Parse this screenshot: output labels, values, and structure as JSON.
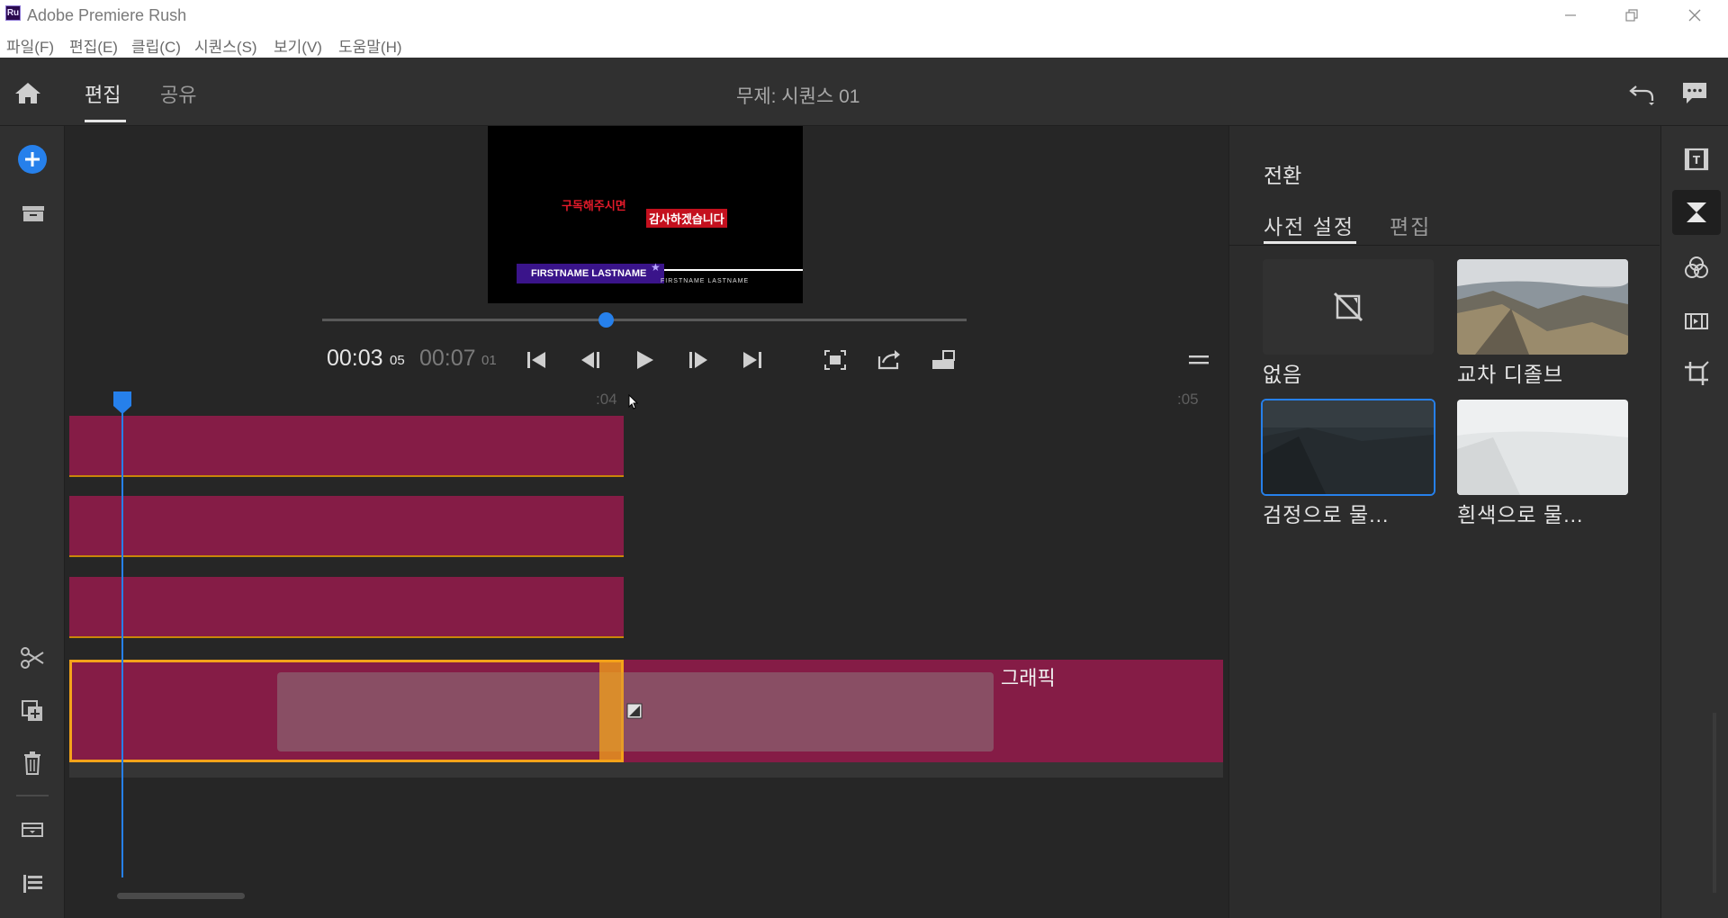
{
  "window": {
    "app_logo": "Ru",
    "title": "Adobe Premiere Rush",
    "buttons": [
      "minimize-icon",
      "restore-icon",
      "close-icon"
    ]
  },
  "menu": {
    "items": [
      "파일(F)",
      "편집(E)",
      "클립(C)",
      "시퀀스(S)",
      "보기(V)",
      "도움말(H)"
    ]
  },
  "header": {
    "tabs": [
      "편집",
      "공유"
    ],
    "active_tab": "편집",
    "project_title": "무제: 시퀀스 01"
  },
  "preview": {
    "red_text": "구독해주시면",
    "highlight_text": "감사하겠습니다",
    "lower_third_name": "FIRSTNAME LASTNAME",
    "lower_third_sub": "FIRSTNAME LASTNAME",
    "scrub_progress": 0.44
  },
  "transport": {
    "current_time": "00:03",
    "current_frames": "05",
    "duration_time": "00:07",
    "duration_frames": "01"
  },
  "timeline": {
    "ruler_labels": [
      ":04",
      ":05"
    ],
    "graphic_track_label": "그래픽"
  },
  "right_panel": {
    "title": "전환",
    "tabs": [
      "사전 설정",
      "편집"
    ],
    "active_tab": "사전 설정",
    "presets": [
      {
        "label": "없음",
        "selected": false
      },
      {
        "label": "교차 디졸브",
        "selected": false
      },
      {
        "label": "검정으로 물...",
        "selected": true
      },
      {
        "label": "흰색으로 물...",
        "selected": false
      }
    ]
  },
  "colors": {
    "accent": "#2680eb",
    "clip": "#851c46",
    "clip_selected_border": "#f4a21a"
  }
}
